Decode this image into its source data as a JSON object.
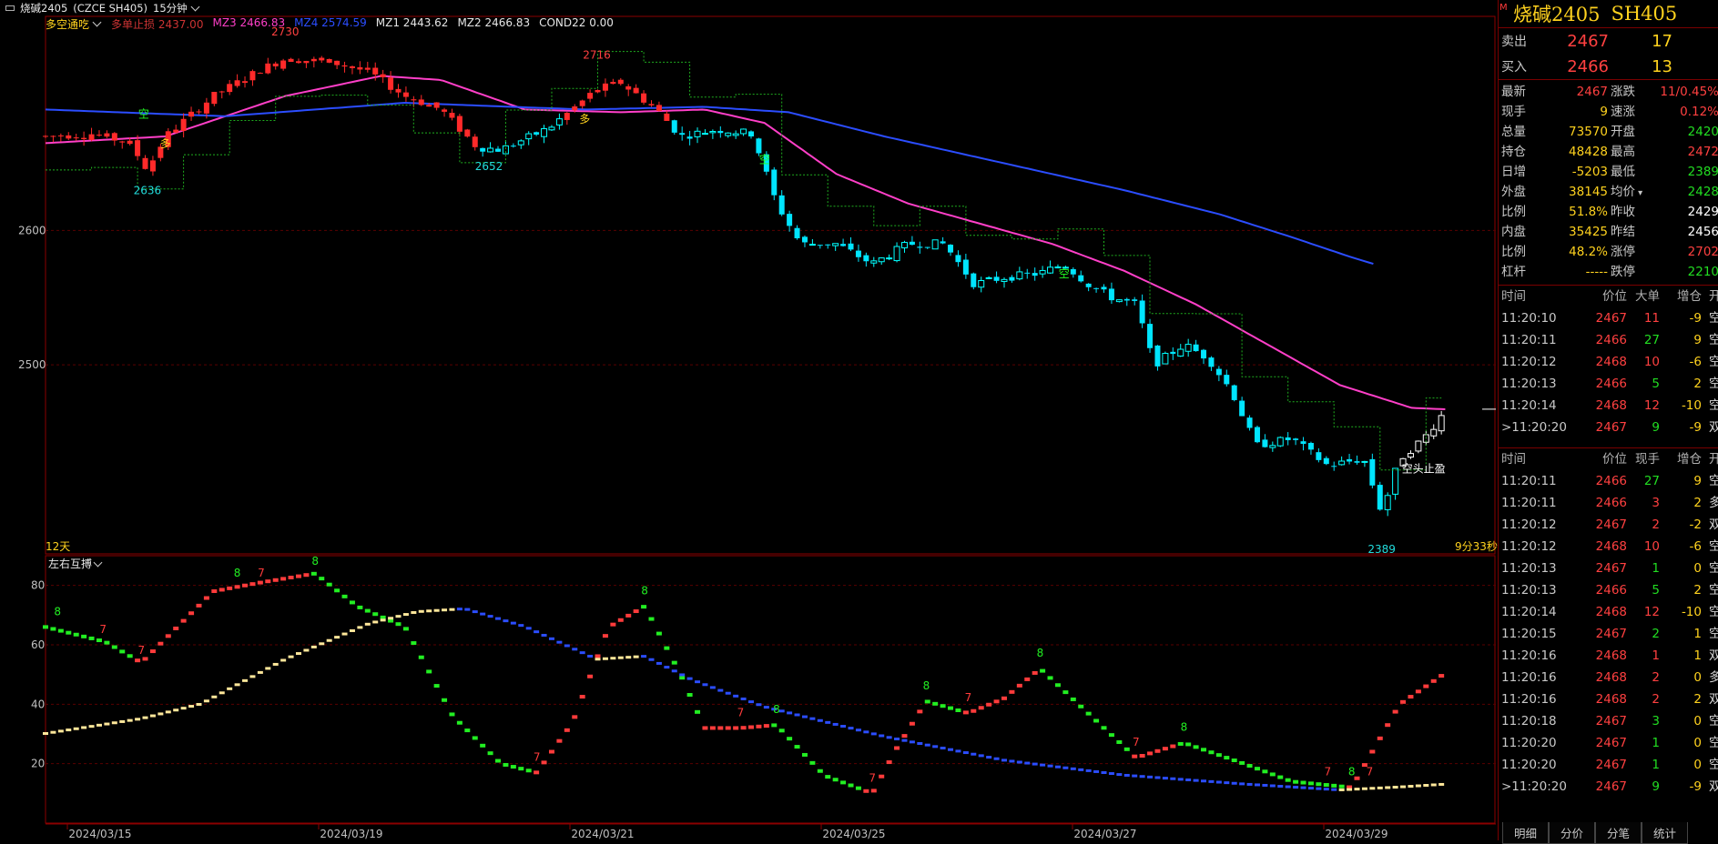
{
  "window": {
    "title": "烧碱2405",
    "code_label": "(CZCE SH405)",
    "period": "15分钟"
  },
  "main_panel": {
    "indicator_name": "多空通吃",
    "legend": [
      {
        "label": "多单止损 2437.00",
        "color": "#cc3333"
      },
      {
        "label": "MZ3 2466.83",
        "color": "#ff3fc8"
      },
      {
        "label": "MZ4 2574.59",
        "color": "#2b4dff"
      },
      {
        "label": "MZ1 2443.62",
        "color": "#e6e6e6"
      },
      {
        "label": "MZ2 2466.83",
        "color": "#e6e6e6"
      },
      {
        "label": "COND22 0.00",
        "color": "#e6e6e6"
      }
    ],
    "y_labels": [
      "2600",
      "2500"
    ],
    "footer_left": "12天",
    "countdown": "9分33秒",
    "annotations": {
      "high1": "2730",
      "high2": "2716",
      "low1": "2636",
      "low2": "2652",
      "low3": "2389",
      "short_tag": "空",
      "long_tag": "多",
      "stop_tag": "空头止盈"
    }
  },
  "sub_panel": {
    "indicator_name": "左右互搏",
    "y_labels": [
      "80",
      "60",
      "40",
      "20"
    ],
    "signal_labels": [
      "8",
      "7"
    ]
  },
  "x_axis_dates": [
    "2024/03/15",
    "2024/03/19",
    "2024/03/21",
    "2024/03/25",
    "2024/03/27",
    "2024/03/29"
  ],
  "quote": {
    "name": "烧碱2405",
    "code": "SH405",
    "marker": "M",
    "ask_label": "卖出",
    "ask_price": "2467",
    "ask_vol": "17",
    "bid_label": "买入",
    "bid_price": "2466",
    "bid_vol": "13",
    "stats": [
      {
        "l1": "最新",
        "v1": "2467",
        "c1": "#ff4040",
        "l2": "涨跌",
        "v2": "11/0.45%",
        "c2": "#ff4040"
      },
      {
        "l1": "现手",
        "v1": "9",
        "c1": "#ffd21e",
        "l2": "速涨",
        "v2": "0.12%",
        "c2": "#ff4040"
      },
      {
        "l1": "总量",
        "v1": "73570",
        "c1": "#ffd21e",
        "l2": "开盘",
        "v2": "2420",
        "c2": "#22dd22"
      },
      {
        "l1": "持仓",
        "v1": "48428",
        "c1": "#ffd21e",
        "l2": "最高",
        "v2": "2472",
        "c2": "#ff4040"
      },
      {
        "l1": "日增",
        "v1": "-5203",
        "c1": "#ffd21e",
        "l2": "最低",
        "v2": "2389",
        "c2": "#22dd22"
      },
      {
        "l1": "外盘",
        "v1": "38145",
        "c1": "#ffd21e",
        "l2": "均价",
        "v2": "2428",
        "c2": "#22dd22"
      },
      {
        "l1": "比例",
        "v1": "51.8%",
        "c1": "#ffd21e",
        "l2": "昨收",
        "v2": "2429",
        "c2": "#ffffff"
      },
      {
        "l1": "内盘",
        "v1": "35425",
        "c1": "#ffd21e",
        "l2": "昨结",
        "v2": "2456",
        "c2": "#ffffff"
      },
      {
        "l1": "比例",
        "v1": "48.2%",
        "c1": "#ffd21e",
        "l2": "涨停",
        "v2": "2702",
        "c2": "#ff4040"
      },
      {
        "l1": "杠杆",
        "v1": "-----",
        "c1": "#ffd21e",
        "l2": "跌停",
        "v2": "2210",
        "c2": "#22dd22"
      }
    ],
    "avg_has_menu": true
  },
  "trades_big": {
    "headers": [
      "时间",
      "价位",
      "大单",
      "增仓",
      "开平"
    ],
    "rows": [
      {
        "time": "11:20:10",
        "price": "2467",
        "vol": "11",
        "vol_color": "#ff4040",
        "chg": "-9",
        "type": "空平"
      },
      {
        "time": "11:20:11",
        "price": "2466",
        "vol": "27",
        "vol_color": "#22dd22",
        "chg": "9",
        "type": "空开"
      },
      {
        "time": "11:20:12",
        "price": "2468",
        "vol": "10",
        "vol_color": "#ff4040",
        "chg": "-6",
        "type": "空平"
      },
      {
        "time": "11:20:13",
        "price": "2466",
        "vol": "5",
        "vol_color": "#22dd22",
        "chg": "2",
        "type": "空开"
      },
      {
        "time": "11:20:14",
        "price": "2468",
        "vol": "12",
        "vol_color": "#ff4040",
        "chg": "-10",
        "type": "空平"
      },
      {
        "time": ">11:20:20",
        "price": "2467",
        "vol": "9",
        "vol_color": "#22dd22",
        "chg": "-9",
        "type": "双平"
      }
    ]
  },
  "trades_tick": {
    "headers": [
      "时间",
      "价位",
      "现手",
      "增仓",
      "开平"
    ],
    "rows": [
      {
        "time": "11:20:11",
        "price": "2466",
        "vol": "27",
        "vol_color": "#22dd22",
        "chg": "9",
        "type": "空开"
      },
      {
        "time": "11:20:11",
        "price": "2466",
        "vol": "3",
        "vol_color": "#ff4040",
        "chg": "2",
        "type": "多开"
      },
      {
        "time": "11:20:12",
        "price": "2467",
        "vol": "2",
        "vol_color": "#ff4040",
        "chg": "-2",
        "type": "双平"
      },
      {
        "time": "11:20:12",
        "price": "2468",
        "vol": "10",
        "vol_color": "#ff4040",
        "chg": "-6",
        "type": "空平"
      },
      {
        "time": "11:20:13",
        "price": "2467",
        "vol": "1",
        "vol_color": "#22dd22",
        "chg": "0",
        "type": "空换"
      },
      {
        "time": "11:20:13",
        "price": "2466",
        "vol": "5",
        "vol_color": "#22dd22",
        "chg": "2",
        "type": "空开"
      },
      {
        "time": "11:20:14",
        "price": "2468",
        "vol": "12",
        "vol_color": "#ff4040",
        "chg": "-10",
        "type": "空平"
      },
      {
        "time": "11:20:15",
        "price": "2467",
        "vol": "2",
        "vol_color": "#22dd22",
        "chg": "1",
        "type": "空开"
      },
      {
        "time": "11:20:16",
        "price": "2468",
        "vol": "1",
        "vol_color": "#ff4040",
        "chg": "1",
        "type": "双开"
      },
      {
        "time": "11:20:16",
        "price": "2468",
        "vol": "2",
        "vol_color": "#ff4040",
        "chg": "0",
        "type": "多换"
      },
      {
        "time": "11:20:16",
        "price": "2468",
        "vol": "2",
        "vol_color": "#ff4040",
        "chg": "2",
        "type": "双开"
      },
      {
        "time": "11:20:18",
        "price": "2467",
        "vol": "3",
        "vol_color": "#22dd22",
        "chg": "0",
        "type": "空换"
      },
      {
        "time": "11:20:20",
        "price": "2467",
        "vol": "1",
        "vol_color": "#22dd22",
        "chg": "0",
        "type": "空换"
      },
      {
        "time": "11:20:20",
        "price": "2467",
        "vol": "1",
        "vol_color": "#22dd22",
        "chg": "0",
        "type": "空换"
      },
      {
        "time": ">11:20:20",
        "price": "2467",
        "vol": "9",
        "vol_color": "#22dd22",
        "chg": "-9",
        "type": "双平"
      }
    ]
  },
  "bottom_tabs": [
    "明细",
    "分价",
    "分笔",
    "统计"
  ],
  "chart_data": [
    {
      "type": "candlestick",
      "title": "多空通吃",
      "y_ticks": [
        2600,
        2500
      ],
      "ylim": [
        2360,
        2760
      ],
      "x_tick_labels": [
        "2024/03/15",
        "2024/03/19",
        "2024/03/21",
        "2024/03/25",
        "2024/03/27",
        "2024/03/29"
      ],
      "price_path": [
        {
          "x": 0,
          "y": 2670
        },
        {
          "x": 0.04,
          "y": 2672
        },
        {
          "x": 0.07,
          "y": 2665
        },
        {
          "x": 0.085,
          "y": 2645
        },
        {
          "x": 0.1,
          "y": 2670
        },
        {
          "x": 0.14,
          "y": 2700
        },
        {
          "x": 0.18,
          "y": 2720
        },
        {
          "x": 0.2,
          "y": 2728
        },
        {
          "x": 0.24,
          "y": 2725
        },
        {
          "x": 0.27,
          "y": 2718
        },
        {
          "x": 0.3,
          "y": 2700
        },
        {
          "x": 0.33,
          "y": 2690
        },
        {
          "x": 0.36,
          "y": 2662
        },
        {
          "x": 0.38,
          "y": 2660
        },
        {
          "x": 0.42,
          "y": 2676
        },
        {
          "x": 0.46,
          "y": 2705
        },
        {
          "x": 0.48,
          "y": 2710
        },
        {
          "x": 0.51,
          "y": 2690
        },
        {
          "x": 0.53,
          "y": 2670
        },
        {
          "x": 0.56,
          "y": 2675
        },
        {
          "x": 0.59,
          "y": 2672
        },
        {
          "x": 0.61,
          "y": 2620
        },
        {
          "x": 0.63,
          "y": 2590
        },
        {
          "x": 0.66,
          "y": 2590
        },
        {
          "x": 0.69,
          "y": 2575
        },
        {
          "x": 0.72,
          "y": 2590
        },
        {
          "x": 0.75,
          "y": 2590
        },
        {
          "x": 0.775,
          "y": 2560
        },
        {
          "x": 0.8,
          "y": 2565
        },
        {
          "x": 0.83,
          "y": 2568
        },
        {
          "x": 0.85,
          "y": 2575
        },
        {
          "x": 0.87,
          "y": 2560
        },
        {
          "x": 0.89,
          "y": 2550
        },
        {
          "x": 0.91,
          "y": 2545
        },
        {
          "x": 0.925,
          "y": 2500
        },
        {
          "x": 0.95,
          "y": 2515
        },
        {
          "x": 0.97,
          "y": 2505
        },
        {
          "x": 0.99,
          "y": 2480
        },
        {
          "x": 1.01,
          "y": 2440
        },
        {
          "x": 1.04,
          "y": 2445
        },
        {
          "x": 1.07,
          "y": 2425
        },
        {
          "x": 1.1,
          "y": 2430
        },
        {
          "x": 1.115,
          "y": 2390
        },
        {
          "x": 1.13,
          "y": 2430
        },
        {
          "x": 1.15,
          "y": 2445
        },
        {
          "x": 1.17,
          "y": 2468
        }
      ],
      "series": [
        {
          "name": "MZ3",
          "values": [
            {
              "x": 0,
              "y": 2665
            },
            {
              "x": 0.1,
              "y": 2670
            },
            {
              "x": 0.2,
              "y": 2700
            },
            {
              "x": 0.28,
              "y": 2715
            },
            {
              "x": 0.33,
              "y": 2712
            },
            {
              "x": 0.4,
              "y": 2690
            },
            {
              "x": 0.48,
              "y": 2688
            },
            {
              "x": 0.55,
              "y": 2690
            },
            {
              "x": 0.6,
              "y": 2680
            },
            {
              "x": 0.66,
              "y": 2642
            },
            {
              "x": 0.72,
              "y": 2620
            },
            {
              "x": 0.78,
              "y": 2605
            },
            {
              "x": 0.84,
              "y": 2590
            },
            {
              "x": 0.9,
              "y": 2570
            },
            {
              "x": 0.96,
              "y": 2545
            },
            {
              "x": 1.02,
              "y": 2515
            },
            {
              "x": 1.08,
              "y": 2485
            },
            {
              "x": 1.14,
              "y": 2468
            },
            {
              "x": 1.17,
              "y": 2466.83
            }
          ]
        },
        {
          "name": "MZ4",
          "values": [
            {
              "x": 0,
              "y": 2690
            },
            {
              "x": 0.15,
              "y": 2685
            },
            {
              "x": 0.3,
              "y": 2695
            },
            {
              "x": 0.45,
              "y": 2690
            },
            {
              "x": 0.55,
              "y": 2692
            },
            {
              "x": 0.62,
              "y": 2688
            },
            {
              "x": 0.7,
              "y": 2670
            },
            {
              "x": 0.8,
              "y": 2650
            },
            {
              "x": 0.9,
              "y": 2630
            },
            {
              "x": 0.98,
              "y": 2612
            },
            {
              "x": 1.04,
              "y": 2595
            },
            {
              "x": 1.09,
              "y": 2580
            },
            {
              "x": 1.11,
              "y": 2574.59
            }
          ]
        }
      ],
      "labels": [
        "2730",
        "2716",
        "2636",
        "2652",
        "2389"
      ],
      "annotations": [
        "空",
        "多",
        "空头止盈"
      ]
    },
    {
      "type": "line",
      "title": "左右互搏",
      "y_ticks": [
        80,
        60,
        40,
        20
      ],
      "ylim": [
        0,
        90
      ],
      "series": [
        {
          "values": [
            {
              "x": 0,
              "y": 66
            },
            {
              "x": 0.05,
              "y": 61
            },
            {
              "x": 0.08,
              "y": 54
            },
            {
              "x": 0.14,
              "y": 78
            },
            {
              "x": 0.18,
              "y": 81
            },
            {
              "x": 0.225,
              "y": 84
            },
            {
              "x": 0.26,
              "y": 73
            },
            {
              "x": 0.3,
              "y": 66
            },
            {
              "x": 0.34,
              "y": 36
            },
            {
              "x": 0.38,
              "y": 20
            },
            {
              "x": 0.41,
              "y": 17
            },
            {
              "x": 0.44,
              "y": 34
            },
            {
              "x": 0.47,
              "y": 66
            },
            {
              "x": 0.5,
              "y": 73
            },
            {
              "x": 0.53,
              "y": 50
            },
            {
              "x": 0.55,
              "y": 32
            },
            {
              "x": 0.58,
              "y": 32
            },
            {
              "x": 0.61,
              "y": 33
            },
            {
              "x": 0.65,
              "y": 16
            },
            {
              "x": 0.69,
              "y": 10
            },
            {
              "x": 0.71,
              "y": 25
            },
            {
              "x": 0.735,
              "y": 41
            },
            {
              "x": 0.77,
              "y": 37
            },
            {
              "x": 0.8,
              "y": 42
            },
            {
              "x": 0.83,
              "y": 52
            },
            {
              "x": 0.87,
              "y": 37
            },
            {
              "x": 0.91,
              "y": 22
            },
            {
              "x": 0.95,
              "y": 27
            },
            {
              "x": 1.0,
              "y": 20
            },
            {
              "x": 1.04,
              "y": 14
            },
            {
              "x": 1.09,
              "y": 12
            },
            {
              "x": 1.13,
              "y": 40
            },
            {
              "x": 1.17,
              "y": 51
            }
          ]
        },
        {
          "values": [
            {
              "x": 0,
              "y": 30
            },
            {
              "x": 0.08,
              "y": 35
            },
            {
              "x": 0.13,
              "y": 40
            },
            {
              "x": 0.2,
              "y": 55
            },
            {
              "x": 0.27,
              "y": 67
            },
            {
              "x": 0.31,
              "y": 71
            },
            {
              "x": 0.35,
              "y": 72
            },
            {
              "x": 0.4,
              "y": 66
            },
            {
              "x": 0.46,
              "y": 55
            },
            {
              "x": 0.5,
              "y": 56
            },
            {
              "x": 0.54,
              "y": 48
            },
            {
              "x": 0.6,
              "y": 39
            },
            {
              "x": 0.7,
              "y": 29
            },
            {
              "x": 0.8,
              "y": 21
            },
            {
              "x": 0.9,
              "y": 16
            },
            {
              "x": 1.0,
              "y": 13
            },
            {
              "x": 1.08,
              "y": 11
            },
            {
              "x": 1.13,
              "y": 12
            },
            {
              "x": 1.17,
              "y": 13
            }
          ]
        }
      ]
    }
  ]
}
